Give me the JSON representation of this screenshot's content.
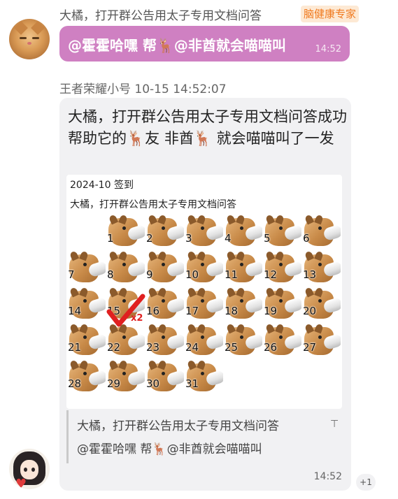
{
  "message1": {
    "sender": "大橘，打开群公告用太子专用文档问答",
    "badge": "脑健康专家",
    "text": "@霍霍哈嘿 帮🦌@非酋就会喵喵叫",
    "time": "14:52"
  },
  "message2": {
    "sender": "王者荣耀小号 10-15 14:52:07",
    "text": "大橘，打开群公告用太子专用文档问答成功帮助它的🦌友 非酋🦌 就会喵喵叫了一发",
    "card": {
      "title": "2024-10 签到",
      "subtitle": "大橘，打开群公告用太子专用文档问答",
      "days": [
        "1",
        "2",
        "3",
        "4",
        "5",
        "6",
        "7",
        "8",
        "9",
        "10",
        "11",
        "12",
        "13",
        "14",
        "15",
        "16",
        "17",
        "18",
        "19",
        "20",
        "21",
        "22",
        "23",
        "24",
        "25",
        "26",
        "27",
        "28",
        "29",
        "30",
        "31"
      ],
      "checked_day": "15",
      "checked_multiplier": "x2"
    },
    "quote": {
      "line1": "大橘，打开群公告用太子专用文档问答",
      "line2": "@霍霍哈嘿 帮🦌@非酋就会喵喵叫",
      "collapse_icon": "collapse-arrow-icon"
    },
    "time": "14:52"
  },
  "reaction": {
    "count": "+1"
  },
  "colors": {
    "purple_bubble": "#cf80c2",
    "grey_bubble": "#f1f1f3",
    "badge_text": "#f07a1f",
    "check": "#e02020"
  }
}
